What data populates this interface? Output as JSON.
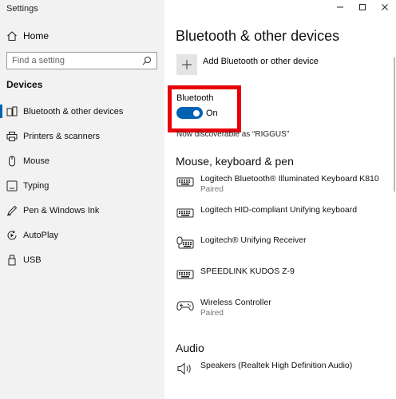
{
  "app": {
    "title": "Settings"
  },
  "sidebar": {
    "home_label": "Home",
    "search_placeholder": "Find a setting",
    "section_title": "Devices",
    "items": [
      {
        "label": "Bluetooth & other devices",
        "icon": "bluetooth-icon",
        "active": true
      },
      {
        "label": "Printers & scanners",
        "icon": "printer-icon"
      },
      {
        "label": "Mouse",
        "icon": "mouse-icon"
      },
      {
        "label": "Typing",
        "icon": "keyboard-icon"
      },
      {
        "label": "Pen & Windows Ink",
        "icon": "pen-icon"
      },
      {
        "label": "AutoPlay",
        "icon": "autoplay-icon"
      },
      {
        "label": "USB",
        "icon": "usb-icon"
      }
    ]
  },
  "main": {
    "title": "Bluetooth & other devices",
    "add_device_label": "Add Bluetooth or other device",
    "bluetooth_label": "Bluetooth",
    "bluetooth_state": "On",
    "discoverable_text": "Now discoverable as “RIGGUS”",
    "mouse_section_title": "Mouse, keyboard & pen",
    "devices": [
      {
        "name": "Logitech Bluetooth® Illuminated Keyboard K810",
        "status": "Paired",
        "icon": "keyboard-icon"
      },
      {
        "name": "Logitech HID-compliant Unifying keyboard",
        "status": "",
        "icon": "keyboard-icon"
      },
      {
        "name": "Logitech® Unifying Receiver",
        "status": "",
        "icon": "keyboard-mouse-icon"
      },
      {
        "name": "SPEEDLINK KUDOS Z-9",
        "status": "",
        "icon": "keyboard-icon"
      },
      {
        "name": "Wireless Controller",
        "status": "Paired",
        "icon": "gamepad-icon"
      }
    ],
    "audio_section_title": "Audio",
    "audio_devices": [
      {
        "name": "Speakers (Realtek High Definition Audio)",
        "status": "",
        "icon": "speaker-icon"
      }
    ]
  },
  "colors": {
    "accent": "#0063b1",
    "highlight": "#e8000b",
    "sidebar_bg": "#f2f2f2"
  }
}
